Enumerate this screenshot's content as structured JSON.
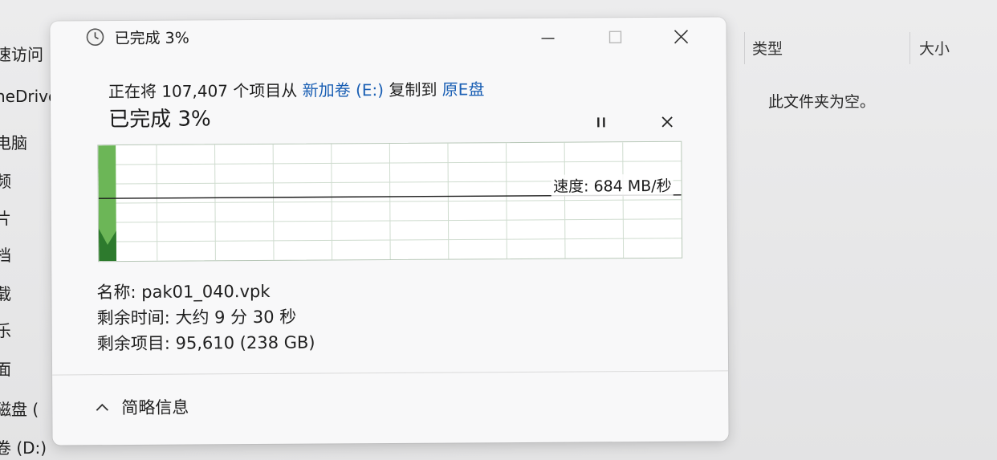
{
  "left_nav": {
    "items": [
      {
        "label": "速访问",
        "top": 0
      },
      {
        "label": "neDrive -"
      },
      {
        "label": "电脑"
      },
      {
        "label": "频"
      },
      {
        "label": "片"
      },
      {
        "label": "档"
      },
      {
        "label": "载"
      },
      {
        "label": "乐"
      },
      {
        "label": "面"
      },
      {
        "label": "磁盘 ("
      },
      {
        "label": "卷 (D:)"
      }
    ]
  },
  "right_pane": {
    "columns": [
      "类型",
      "大小"
    ],
    "empty_message": "此文件夹为空。"
  },
  "dialog": {
    "title": "已完成 3%",
    "heading": {
      "prefix": "正在将 107,407 个项目从 ",
      "source": "新加卷 (E:)",
      "middle": " 复制到 ",
      "destination": "原E盘"
    },
    "progress_title": "已完成 3%",
    "speed": "速度: 684 MB/秒",
    "details": {
      "name": "名称: pak01_040.vpk",
      "time_remaining": "剩余时间: 大约 9 分 30 秒",
      "items_remaining": "剩余项目: 95,610 (238 GB)"
    },
    "footer_toggle": "简略信息",
    "progress_percent": 3,
    "colors": {
      "fill_light": "#6cb657",
      "fill_dark": "#2d7a2d",
      "grid": "#cfdccf",
      "link": "#1a5fb4"
    }
  }
}
